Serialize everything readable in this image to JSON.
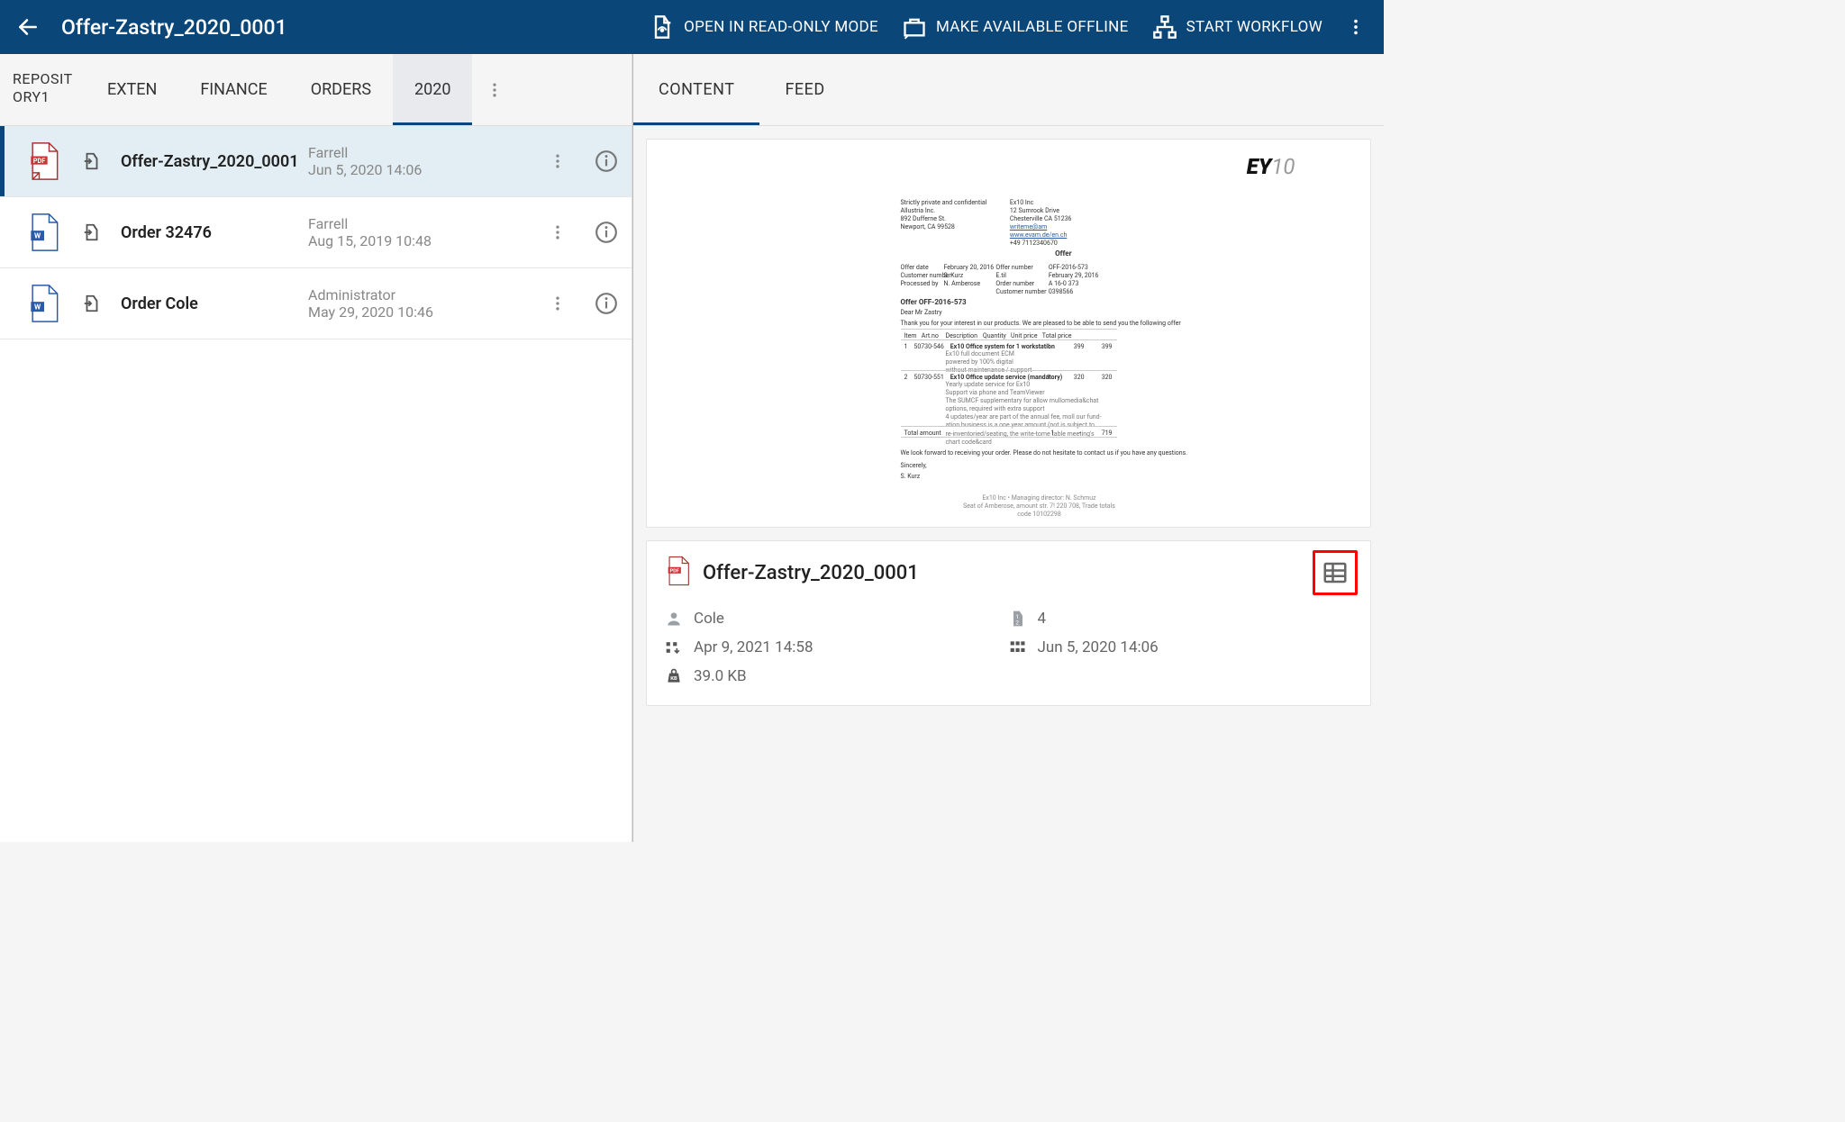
{
  "header": {
    "title": "Offer-Zastry_2020_0001",
    "actions": {
      "readonly": "OPEN IN READ-ONLY MODE",
      "offline": "MAKE AVAILABLE OFFLINE",
      "workflow": "START WORKFLOW"
    }
  },
  "breadcrumb": {
    "root": "REPOSITORY1",
    "items": [
      "EXTEN",
      "FINANCE",
      "ORDERS",
      "2020"
    ],
    "active_index": 3
  },
  "list": [
    {
      "name": "Offer-Zastry_2020_0001",
      "author": "Farrell",
      "date": "Jun 5, 2020 14:06",
      "type": "pdf",
      "selected": true
    },
    {
      "name": "Order 32476",
      "author": "Farrell",
      "date": "Aug 15, 2019 10:48",
      "type": "doc",
      "selected": false
    },
    {
      "name": "Order Cole",
      "author": "Administrator",
      "date": "May 29, 2020 10:46",
      "type": "doc",
      "selected": false
    }
  ],
  "right_tabs": {
    "items": [
      "CONTENT",
      "FEED"
    ],
    "active_index": 0
  },
  "info": {
    "title": "Offer-Zastry_2020_0001",
    "owner": "Cole",
    "pages": "4",
    "modified": "Apr 9, 2021 14:58",
    "created": "Jun 5, 2020 14:06",
    "size": "39.0 KB"
  },
  "preview": {
    "doc_title": "Offer OFF-2016-573",
    "greeting": "Dear Mr Zastry"
  }
}
